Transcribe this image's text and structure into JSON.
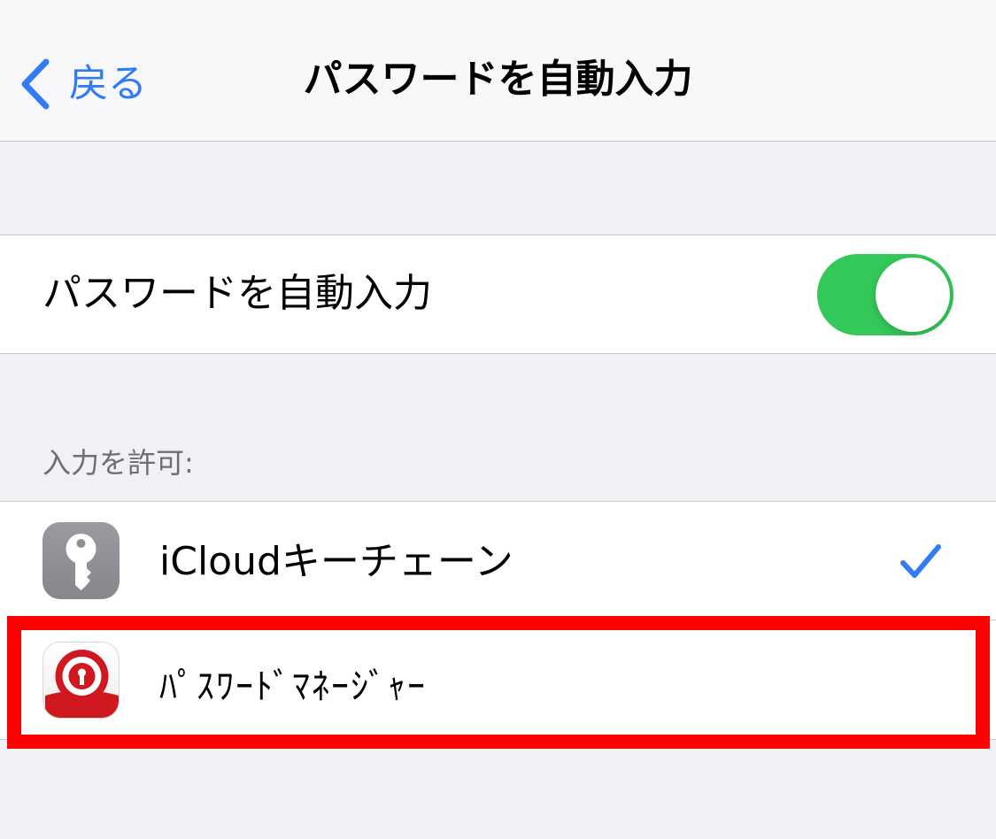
{
  "navbar": {
    "back_label": "戻る",
    "title": "パスワードを自動入力",
    "back_icon": "chevron-left-icon",
    "accent_color": "#2f7cf6"
  },
  "autofill": {
    "label": "パスワードを自動入力",
    "toggle_on": true,
    "toggle_color": "#34c759"
  },
  "allow_section": {
    "header": "入力を許可:",
    "items": [
      {
        "label": "iCloudキーチェーン",
        "icon": "key-icon",
        "checked": true
      },
      {
        "label": "ﾊﾟｽﾜｰﾄﾞﾏﾈｰｼﾞｬｰ",
        "icon": "password-manager-app-icon",
        "checked": false,
        "highlighted": true
      }
    ]
  },
  "highlight_color": "#ff0000"
}
